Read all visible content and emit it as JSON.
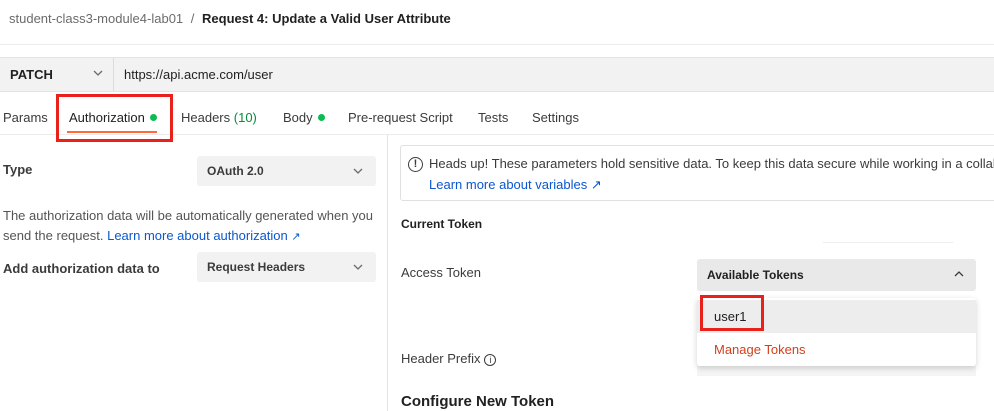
{
  "breadcrumb": {
    "parent": "student-class3-module4-lab01",
    "separator": "/",
    "current": "Request 4: Update a Valid User Attribute"
  },
  "request": {
    "method": "PATCH",
    "url": "https://api.acme.com/user"
  },
  "tabs": [
    {
      "label": "Params"
    },
    {
      "label": "Authorization",
      "active": true,
      "status_dot": true
    },
    {
      "label": "Headers",
      "count": "(10)"
    },
    {
      "label": "Body",
      "status_dot": true
    },
    {
      "label": "Pre-request Script"
    },
    {
      "label": "Tests"
    },
    {
      "label": "Settings"
    }
  ],
  "auth": {
    "type_label": "Type",
    "type_value": "OAuth 2.0",
    "description_line1": "The authorization data will be automatically generated when you",
    "description_line2_prefix": "send the request.",
    "description_link": "Learn more about authorization",
    "link_arrow": "↗",
    "add_to_label": "Add authorization data to",
    "add_to_value": "Request Headers"
  },
  "alert": {
    "icon": "!",
    "text": "Heads up! These parameters hold sensitive data. To keep this data secure while working in a collabo",
    "link": "Learn more about variables ↗"
  },
  "current_token": {
    "section_title": "Current Token",
    "access_token_label": "Access Token",
    "header_prefix_label": "Header Prefix",
    "info_icon": "i"
  },
  "tokens_dropdown": {
    "selected_label": "Available Tokens",
    "items": [
      "user1"
    ],
    "manage_label": "Manage Tokens"
  },
  "configure": {
    "title": "Configure New Token"
  },
  "colors": {
    "accent": "#ff6c37",
    "highlight": "#e8221b",
    "link": "#0b57d0",
    "status_dot": "#0cbb52",
    "manage_tokens": "#d23f1c"
  }
}
